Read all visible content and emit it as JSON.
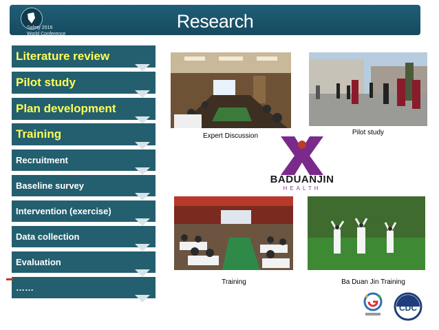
{
  "header": {
    "title": "Research",
    "logo_line1": "Safety 2016",
    "logo_line2": "World Conference"
  },
  "steps": [
    {
      "label": "Literature review",
      "size": "big"
    },
    {
      "label": "Pilot study",
      "size": "big"
    },
    {
      "label": "Plan development",
      "size": "big"
    },
    {
      "label": "Training",
      "size": "big"
    },
    {
      "label": "Recruitment",
      "size": "small"
    },
    {
      "label": "Baseline survey",
      "size": "small"
    },
    {
      "label": "Intervention (exercise)",
      "size": "small"
    },
    {
      "label": "Data collection",
      "size": "small"
    },
    {
      "label": "Evaluation",
      "size": "small"
    },
    {
      "label": "……",
      "size": "small"
    }
  ],
  "photos": {
    "expert_discussion": "Expert Discussion",
    "pilot_study": "Pilot study",
    "training": "Training",
    "baduanjin_training": "Ba Duan Jin Training"
  },
  "brand": {
    "word": "BADUANJIN",
    "sub": "HEALTH"
  },
  "cdc_label": "CDC",
  "colors": {
    "banner": "#1f5f78",
    "step_bg": "#235f6f",
    "highlight_text": "#ffff55",
    "arrow": "#d6e4ea"
  }
}
